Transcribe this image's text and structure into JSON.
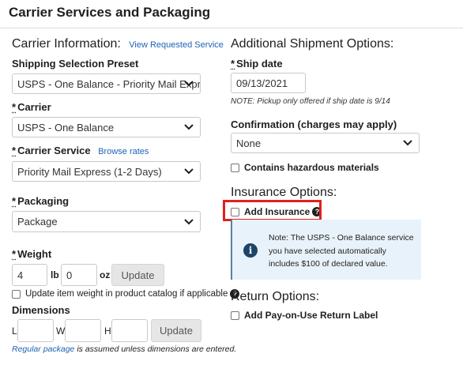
{
  "page": {
    "title": "Carrier Services and Packaging"
  },
  "carrier_info": {
    "heading": "Carrier Information:",
    "view_link": "View Requested Service",
    "preset_label": "Shipping Selection Preset",
    "preset_value": "USPS - One Balance - Priority Mail Expre",
    "carrier_label": "Carrier",
    "carrier_value": "USPS - One Balance",
    "service_label": "Carrier Service",
    "browse_link": "Browse rates",
    "service_value": "Priority Mail Express (1-2 Days)",
    "packaging_label": "Packaging",
    "packaging_value": "Package",
    "required_mark": "*",
    "weight_label": "Weight",
    "weight_lb": "4",
    "lb_unit": "lb",
    "weight_oz": "0",
    "oz_unit": "oz",
    "update_label": "Update",
    "update_weight_text": "Update item weight in product catalog if applicable",
    "dimensions_label": "Dimensions",
    "dim_l": "L",
    "dim_w": "W",
    "dim_h": "H",
    "dim_update_label": "Update",
    "regular_link": "Regular package",
    "regular_note": "is assumed unless dimensions are entered."
  },
  "additional": {
    "heading": "Additional Shipment Options:",
    "ship_date_label": "Ship date",
    "ship_date_value": "09/13/2021",
    "ship_date_note": "NOTE: Pickup only offered if ship date is 9/14",
    "confirmation_label": "Confirmation (charges may apply)",
    "confirmation_value": "None",
    "hazardous_label": "Contains hazardous materials"
  },
  "insurance": {
    "heading": "Insurance Options:",
    "add_label": "Add Insurance",
    "info_text": "Note: The USPS - One Balance service you have selected automatically includes $100 of declared value."
  },
  "return": {
    "heading": "Return Options:",
    "pay_on_use_label": "Add Pay-on-Use Return Label"
  },
  "colors": {
    "link": "#1f63b6",
    "highlight": "#e3201b",
    "info_bg": "#e8f2fa",
    "info_icon": "#1d4469"
  },
  "icons": {
    "chevron": "chevron-down-icon",
    "help": "question-circle-icon",
    "info": "info-circle-icon"
  }
}
